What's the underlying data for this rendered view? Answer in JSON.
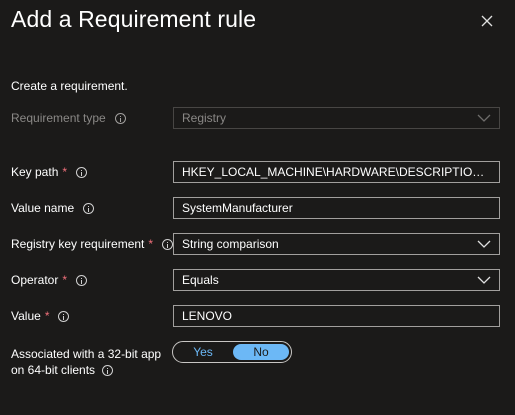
{
  "panel": {
    "title": "Add a Requirement rule",
    "subtitle": "Create a requirement."
  },
  "icons": {
    "close": "close-icon",
    "info": "info-icon",
    "chevron": "chevron-down-icon"
  },
  "colors": {
    "background": "#1b1a19",
    "required_asterisk": "#f1707b",
    "toggle_accent": "#6cb8f6"
  },
  "form": {
    "requirement_type": {
      "label": "Requirement type",
      "value": "Registry"
    },
    "key_path": {
      "label": "Key path",
      "required": "*",
      "value": "HKEY_LOCAL_MACHINE\\HARDWARE\\DESCRIPTION\\Syste..."
    },
    "value_name": {
      "label": "Value name",
      "value": "SystemManufacturer"
    },
    "registry_key_requirement": {
      "label": "Registry key requirement",
      "required": "*",
      "value": "String comparison"
    },
    "operator": {
      "label": "Operator",
      "required": "*",
      "value": "Equals"
    },
    "value": {
      "label": "Value",
      "required": "*",
      "value": "LENOVO"
    },
    "bit32": {
      "label_line1": "Associated with a 32-bit app",
      "label_line2": "on 64-bit clients",
      "yes": "Yes",
      "no": "No",
      "selected": "No"
    }
  }
}
